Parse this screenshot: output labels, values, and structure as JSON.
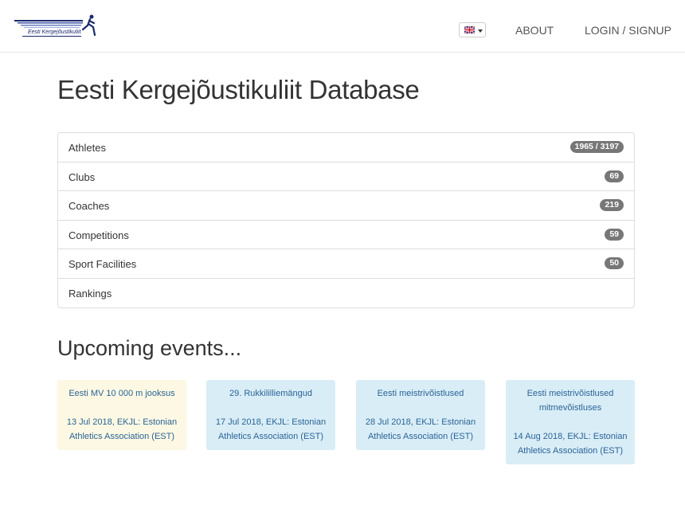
{
  "header": {
    "logo_text": "Eesti Kergejõustikuliit",
    "language": "English",
    "about_label": "ABOUT",
    "login_label": "LOGIN / SIGNUP"
  },
  "main": {
    "title": "Eesti Kergejõustikuliit Database",
    "items": [
      {
        "label": "Athletes",
        "count": "1965 / 3197"
      },
      {
        "label": "Clubs",
        "count": "69"
      },
      {
        "label": "Coaches",
        "count": "219"
      },
      {
        "label": "Competitions",
        "count": "59"
      },
      {
        "label": "Sport Facilities",
        "count": "50"
      },
      {
        "label": "Rankings",
        "count": ""
      }
    ]
  },
  "upcoming": {
    "title": "Upcoming events...",
    "events": [
      {
        "name": "Eesti MV 10 000 m jooksus",
        "details": "13 Jul 2018, EKJL: Estonian Athletics Association (EST)"
      },
      {
        "name": "29. Rukkililliemängud",
        "details": "17 Jul 2018, EKJL: Estonian Athletics Association (EST)"
      },
      {
        "name": "Eesti meistrivõistlused",
        "details": "28 Jul 2018, EKJL: Estonian Athletics Association (EST)"
      },
      {
        "name": "Eesti meistrivõistlused mitmevõistluses",
        "details": "14 Aug 2018, EKJL: Estonian Athletics Association (EST)"
      }
    ]
  },
  "colors": {
    "badge": "#777777",
    "event_highlight": "#fcf8e3",
    "event_default": "#d9edf7",
    "link": "#2a6496"
  }
}
